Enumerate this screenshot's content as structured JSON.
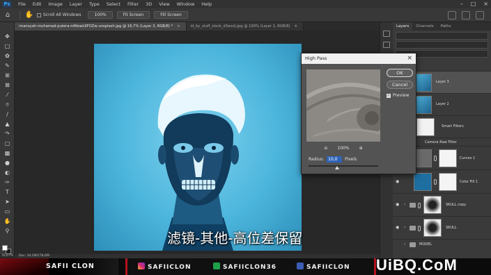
{
  "menubar": {
    "logo": "Ps",
    "items": [
      "File",
      "Edit",
      "Image",
      "Layer",
      "Type",
      "Select",
      "Filter",
      "3D",
      "View",
      "Window",
      "Help"
    ]
  },
  "options_bar": {
    "scroll_all_windows": "Scroll All Windows",
    "btn_100": "100%",
    "btn_fit": "Fit Screen",
    "btn_fill": "Fill Screen"
  },
  "doc_tabs": [
    {
      "label": "imansyah-muhamad-putera-n4KewLKFOZw-unsplash.jpg @ 16,7% (Layer 3, RGB/8) *",
      "close": "×"
    },
    {
      "label": "id_by_stuff_stock_d3eoslj.jpg @ 100% (Layer 1, RGB/8)",
      "close": "×"
    }
  ],
  "status": {
    "zoom": "16,67%",
    "doc": "Doc: 34,2M/178,6M"
  },
  "layers_panel": {
    "tabs": [
      "Layers",
      "Channels",
      "Paths"
    ],
    "layers": [
      {
        "name": "Layer 3"
      },
      {
        "name": "Layer 2"
      },
      {
        "name": "Smart Filters"
      },
      {
        "name": "Camera Raw Filter"
      },
      {
        "name": "Curves 1"
      },
      {
        "name": "Color Fill 1"
      },
      {
        "name": "SKULL copy"
      },
      {
        "name": "SKULL"
      },
      {
        "name": "MODEL"
      }
    ]
  },
  "dialog": {
    "title": "High Pass",
    "close": "×",
    "ok": "OK",
    "cancel": "Cancel",
    "preview": "Preview",
    "preview_checked": "✓",
    "zoom": "100%",
    "zoom_out": "⊖",
    "zoom_in": "⊕",
    "radius_label": "Radius:",
    "radius_value": "10,0",
    "radius_unit": "Pixels"
  },
  "subtitle": "滤镜-其他-高位差保留",
  "banner": {
    "name": "SAFII CLON",
    "instagram": "SAFIICLON",
    "twitter": "SAFIICLON36",
    "facebook": "SAFIICLON",
    "watermark_a": "UiBQ",
    "watermark_b": ".",
    "watermark_c": "CoM"
  },
  "colors": {
    "photo_cyan": "#4cb5dc",
    "accent_red": "#b3121d",
    "selection_blue": "#2e64b8"
  }
}
